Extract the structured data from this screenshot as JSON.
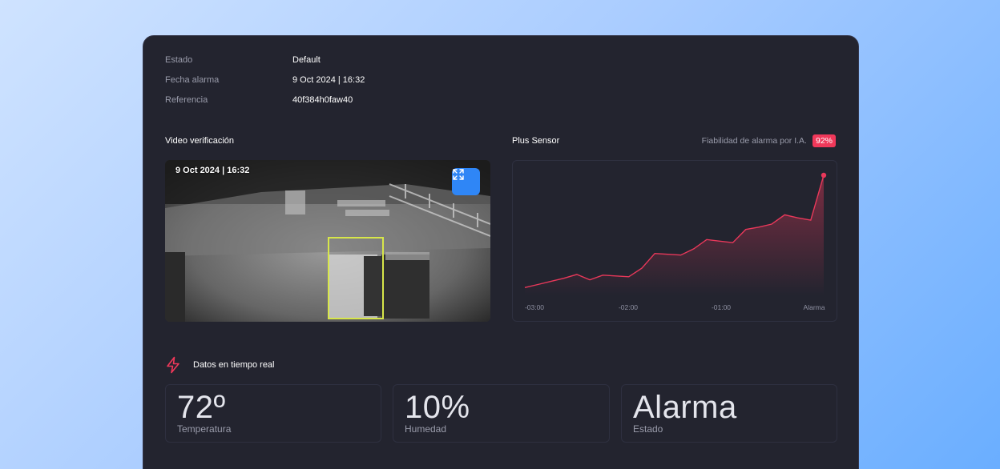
{
  "meta": [
    {
      "label": "Estado",
      "value": "Default"
    },
    {
      "label": "Fecha alarma",
      "value": "9 Oct 2024 | 16:32"
    },
    {
      "label": "Referencia",
      "value": "40f384h0faw40"
    }
  ],
  "video": {
    "title": "Video verificación",
    "timestamp": "9 Oct 2024 | 16:32",
    "expand_icon": "expand-icon"
  },
  "sensor": {
    "title": "Plus Sensor",
    "reliability_label": "Fiabilidad de alarma por I.A.",
    "reliability_value": "92%"
  },
  "chart_data": {
    "type": "area",
    "x_ticks": [
      "-03:00",
      "-02:00",
      "-01:00",
      "Alarma"
    ],
    "series": [
      {
        "values": [
          0.1,
          0.14,
          0.18,
          0.22,
          0.27,
          0.2,
          0.26,
          0.25,
          0.24,
          0.35,
          0.54,
          0.53,
          0.52,
          0.6,
          0.72,
          0.7,
          0.68,
          0.85,
          0.88,
          0.92,
          1.04,
          1.0,
          0.97,
          1.55
        ]
      }
    ],
    "line_color": "#e8385a"
  },
  "realtime": {
    "title": "Datos en tiempo real",
    "icon": "lightning-icon",
    "cards": [
      {
        "value": "72º",
        "label": "Temperatura"
      },
      {
        "value": "10%",
        "label": "Humedad"
      },
      {
        "value": "Alarma",
        "label": "Estado"
      }
    ]
  }
}
